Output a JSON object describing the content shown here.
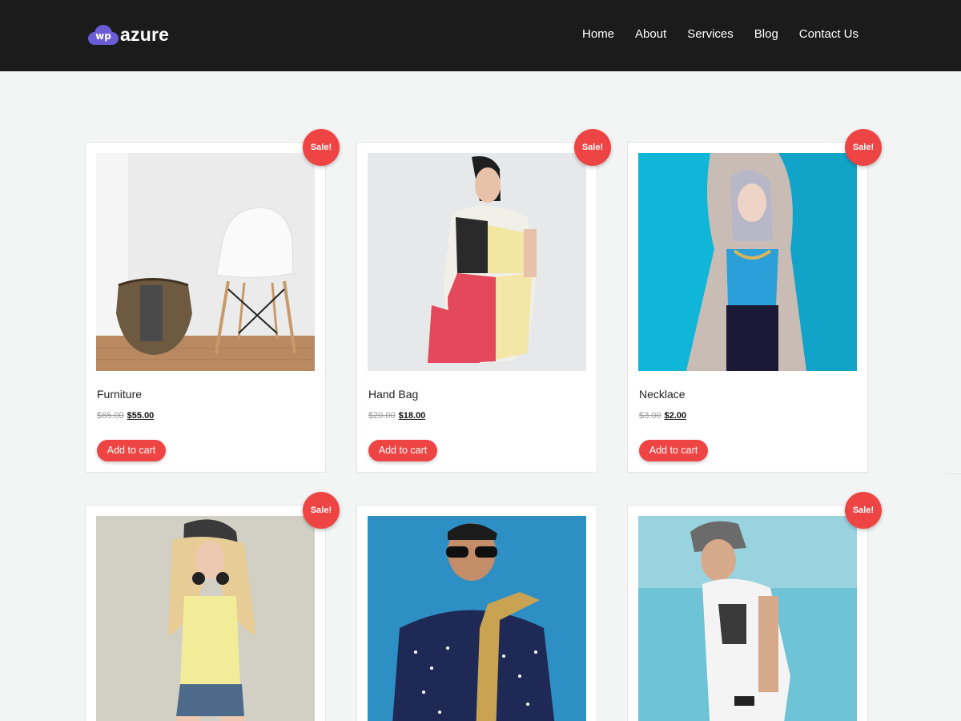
{
  "site": {
    "logo_badge": "wp",
    "logo_text": "azure"
  },
  "nav": {
    "items": [
      "Home",
      "About",
      "Services",
      "Blog",
      "Contact Us"
    ]
  },
  "products": [
    {
      "name": "Furniture",
      "old_price": "$65.00",
      "price": "$55.00",
      "badge": "Sale!",
      "button": "Add to cart"
    },
    {
      "name": "Hand Bag",
      "old_price": "$20.00",
      "price": "$18.00",
      "badge": "Sale!",
      "button": "Add to cart"
    },
    {
      "name": "Necklace",
      "old_price": "$3.00",
      "price": "$2.00",
      "badge": "Sale!",
      "button": "Add to cart"
    },
    {
      "badge": "Sale!"
    },
    {},
    {
      "badge": "Sale!"
    }
  ],
  "colors": {
    "header_bg": "#1b1b1b",
    "accent": "#ef4444",
    "logo_purple": "#6b5cd6",
    "page_bg": "#f3f4f4"
  }
}
